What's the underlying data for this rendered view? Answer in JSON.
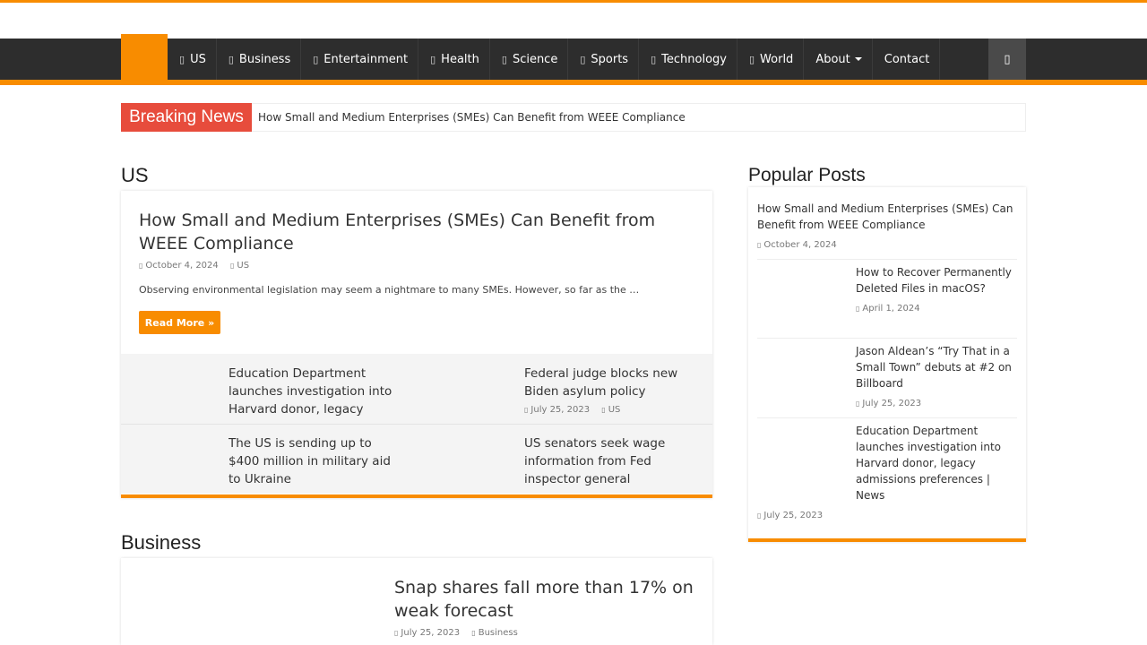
{
  "nav": {
    "items": [
      {
        "label": "US",
        "icon": "document-icon"
      },
      {
        "label": "Business",
        "icon": "document-icon"
      },
      {
        "label": "Entertainment",
        "icon": "document-icon"
      },
      {
        "label": "Health",
        "icon": "document-icon"
      },
      {
        "label": "Science",
        "icon": "document-icon"
      },
      {
        "label": "Sports",
        "icon": "document-icon"
      },
      {
        "label": "Technology",
        "icon": "document-icon"
      },
      {
        "label": "World",
        "icon": "document-icon"
      },
      {
        "label": "About",
        "icon": ""
      },
      {
        "label": "Contact",
        "icon": ""
      }
    ],
    "icon_glyph": "▯",
    "search_glyph": "▯"
  },
  "breaking": {
    "label": "Breaking News",
    "text": "How Small and Medium Enterprises (SMEs) Can Benefit from WEEE Compliance"
  },
  "colors": {
    "accent": "#f88c00",
    "breaking": "#e74c3c",
    "nav": "#2d2d2d"
  },
  "us_section": {
    "title": "US",
    "main": {
      "title": "How Small and Medium Enterprises (SMEs) Can Benefit from WEEE Compliance",
      "date": "October 4, 2024",
      "category": "US",
      "excerpt": "Observing environmental legislation may seem a nightmare to many SMEs. However, so far as the …",
      "read_more": "Read More »"
    },
    "grid": [
      {
        "title": "Education Department launches investigation into Harvard donor, legacy admissions preferences | News"
      },
      {
        "title": "Federal judge blocks new Biden asylum policy",
        "date": "July 25, 2023",
        "category": "US"
      },
      {
        "title": "The US is sending up to $400 million in military aid to Ukraine"
      },
      {
        "title": "US senators seek wage information from Fed inspector general"
      }
    ]
  },
  "business_section": {
    "title": "Business",
    "main": {
      "title": "Snap shares fall more than 17% on weak forecast",
      "date": "July 25, 2023",
      "category": "Business"
    }
  },
  "popular": {
    "title": "Popular Posts",
    "posts": [
      {
        "title": "How Small and Medium Enterprises (SMEs) Can Benefit from WEEE Compliance",
        "date": "October 4, 2024"
      },
      {
        "title": "How to Recover Permanently Deleted Files in macOS?",
        "date": "April 1, 2024"
      },
      {
        "title": "Jason Aldean’s “Try That in a Small Town” debuts at #2 on Billboard",
        "date": "July 25, 2023"
      },
      {
        "title": "Education Department launches investigation into Harvard donor, legacy admissions preferences | News",
        "date": "July 25, 2023"
      }
    ]
  }
}
